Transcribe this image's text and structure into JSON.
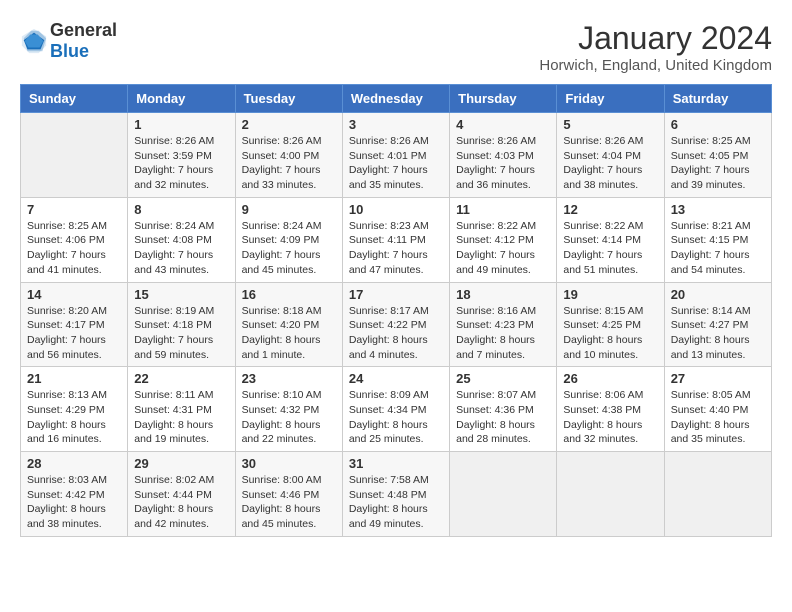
{
  "header": {
    "logo_general": "General",
    "logo_blue": "Blue",
    "month_title": "January 2024",
    "location": "Horwich, England, United Kingdom"
  },
  "days_of_week": [
    "Sunday",
    "Monday",
    "Tuesday",
    "Wednesday",
    "Thursday",
    "Friday",
    "Saturday"
  ],
  "weeks": [
    [
      {
        "day": "",
        "sunrise": "",
        "sunset": "",
        "daylight": ""
      },
      {
        "day": "1",
        "sunrise": "Sunrise: 8:26 AM",
        "sunset": "Sunset: 3:59 PM",
        "daylight": "Daylight: 7 hours and 32 minutes."
      },
      {
        "day": "2",
        "sunrise": "Sunrise: 8:26 AM",
        "sunset": "Sunset: 4:00 PM",
        "daylight": "Daylight: 7 hours and 33 minutes."
      },
      {
        "day": "3",
        "sunrise": "Sunrise: 8:26 AM",
        "sunset": "Sunset: 4:01 PM",
        "daylight": "Daylight: 7 hours and 35 minutes."
      },
      {
        "day": "4",
        "sunrise": "Sunrise: 8:26 AM",
        "sunset": "Sunset: 4:03 PM",
        "daylight": "Daylight: 7 hours and 36 minutes."
      },
      {
        "day": "5",
        "sunrise": "Sunrise: 8:26 AM",
        "sunset": "Sunset: 4:04 PM",
        "daylight": "Daylight: 7 hours and 38 minutes."
      },
      {
        "day": "6",
        "sunrise": "Sunrise: 8:25 AM",
        "sunset": "Sunset: 4:05 PM",
        "daylight": "Daylight: 7 hours and 39 minutes."
      }
    ],
    [
      {
        "day": "7",
        "sunrise": "Sunrise: 8:25 AM",
        "sunset": "Sunset: 4:06 PM",
        "daylight": "Daylight: 7 hours and 41 minutes."
      },
      {
        "day": "8",
        "sunrise": "Sunrise: 8:24 AM",
        "sunset": "Sunset: 4:08 PM",
        "daylight": "Daylight: 7 hours and 43 minutes."
      },
      {
        "day": "9",
        "sunrise": "Sunrise: 8:24 AM",
        "sunset": "Sunset: 4:09 PM",
        "daylight": "Daylight: 7 hours and 45 minutes."
      },
      {
        "day": "10",
        "sunrise": "Sunrise: 8:23 AM",
        "sunset": "Sunset: 4:11 PM",
        "daylight": "Daylight: 7 hours and 47 minutes."
      },
      {
        "day": "11",
        "sunrise": "Sunrise: 8:22 AM",
        "sunset": "Sunset: 4:12 PM",
        "daylight": "Daylight: 7 hours and 49 minutes."
      },
      {
        "day": "12",
        "sunrise": "Sunrise: 8:22 AM",
        "sunset": "Sunset: 4:14 PM",
        "daylight": "Daylight: 7 hours and 51 minutes."
      },
      {
        "day": "13",
        "sunrise": "Sunrise: 8:21 AM",
        "sunset": "Sunset: 4:15 PM",
        "daylight": "Daylight: 7 hours and 54 minutes."
      }
    ],
    [
      {
        "day": "14",
        "sunrise": "Sunrise: 8:20 AM",
        "sunset": "Sunset: 4:17 PM",
        "daylight": "Daylight: 7 hours and 56 minutes."
      },
      {
        "day": "15",
        "sunrise": "Sunrise: 8:19 AM",
        "sunset": "Sunset: 4:18 PM",
        "daylight": "Daylight: 7 hours and 59 minutes."
      },
      {
        "day": "16",
        "sunrise": "Sunrise: 8:18 AM",
        "sunset": "Sunset: 4:20 PM",
        "daylight": "Daylight: 8 hours and 1 minute."
      },
      {
        "day": "17",
        "sunrise": "Sunrise: 8:17 AM",
        "sunset": "Sunset: 4:22 PM",
        "daylight": "Daylight: 8 hours and 4 minutes."
      },
      {
        "day": "18",
        "sunrise": "Sunrise: 8:16 AM",
        "sunset": "Sunset: 4:23 PM",
        "daylight": "Daylight: 8 hours and 7 minutes."
      },
      {
        "day": "19",
        "sunrise": "Sunrise: 8:15 AM",
        "sunset": "Sunset: 4:25 PM",
        "daylight": "Daylight: 8 hours and 10 minutes."
      },
      {
        "day": "20",
        "sunrise": "Sunrise: 8:14 AM",
        "sunset": "Sunset: 4:27 PM",
        "daylight": "Daylight: 8 hours and 13 minutes."
      }
    ],
    [
      {
        "day": "21",
        "sunrise": "Sunrise: 8:13 AM",
        "sunset": "Sunset: 4:29 PM",
        "daylight": "Daylight: 8 hours and 16 minutes."
      },
      {
        "day": "22",
        "sunrise": "Sunrise: 8:11 AM",
        "sunset": "Sunset: 4:31 PM",
        "daylight": "Daylight: 8 hours and 19 minutes."
      },
      {
        "day": "23",
        "sunrise": "Sunrise: 8:10 AM",
        "sunset": "Sunset: 4:32 PM",
        "daylight": "Daylight: 8 hours and 22 minutes."
      },
      {
        "day": "24",
        "sunrise": "Sunrise: 8:09 AM",
        "sunset": "Sunset: 4:34 PM",
        "daylight": "Daylight: 8 hours and 25 minutes."
      },
      {
        "day": "25",
        "sunrise": "Sunrise: 8:07 AM",
        "sunset": "Sunset: 4:36 PM",
        "daylight": "Daylight: 8 hours and 28 minutes."
      },
      {
        "day": "26",
        "sunrise": "Sunrise: 8:06 AM",
        "sunset": "Sunset: 4:38 PM",
        "daylight": "Daylight: 8 hours and 32 minutes."
      },
      {
        "day": "27",
        "sunrise": "Sunrise: 8:05 AM",
        "sunset": "Sunset: 4:40 PM",
        "daylight": "Daylight: 8 hours and 35 minutes."
      }
    ],
    [
      {
        "day": "28",
        "sunrise": "Sunrise: 8:03 AM",
        "sunset": "Sunset: 4:42 PM",
        "daylight": "Daylight: 8 hours and 38 minutes."
      },
      {
        "day": "29",
        "sunrise": "Sunrise: 8:02 AM",
        "sunset": "Sunset: 4:44 PM",
        "daylight": "Daylight: 8 hours and 42 minutes."
      },
      {
        "day": "30",
        "sunrise": "Sunrise: 8:00 AM",
        "sunset": "Sunset: 4:46 PM",
        "daylight": "Daylight: 8 hours and 45 minutes."
      },
      {
        "day": "31",
        "sunrise": "Sunrise: 7:58 AM",
        "sunset": "Sunset: 4:48 PM",
        "daylight": "Daylight: 8 hours and 49 minutes."
      },
      {
        "day": "",
        "sunrise": "",
        "sunset": "",
        "daylight": ""
      },
      {
        "day": "",
        "sunrise": "",
        "sunset": "",
        "daylight": ""
      },
      {
        "day": "",
        "sunrise": "",
        "sunset": "",
        "daylight": ""
      }
    ]
  ]
}
